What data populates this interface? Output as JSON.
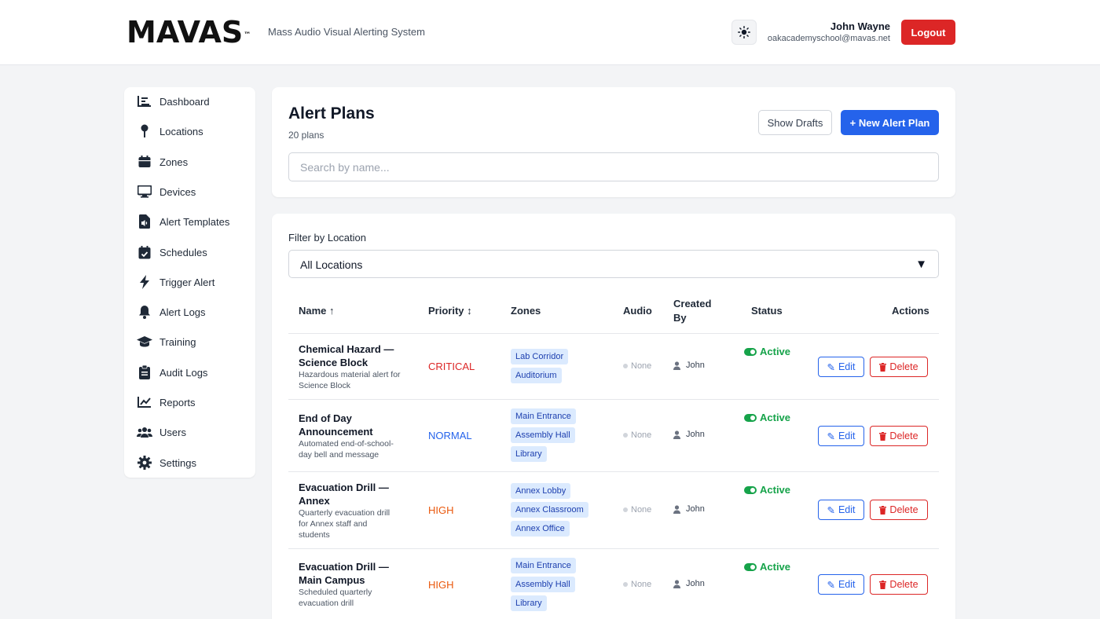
{
  "header": {
    "logo": "MAVAS",
    "logo_tm": "™",
    "tagline": "Mass Audio Visual Alerting System",
    "theme_icon": "sun-icon",
    "user_name": "John Wayne",
    "user_email": "oakacademyschool@mavas.net",
    "logout_label": "Logout"
  },
  "sidebar": {
    "items": [
      {
        "label": "Dashboard",
        "icon": "chart-icon"
      },
      {
        "label": "Locations",
        "icon": "pin-icon"
      },
      {
        "label": "Zones",
        "icon": "calendar-box-icon"
      },
      {
        "label": "Devices",
        "icon": "monitor-icon"
      },
      {
        "label": "Alert Templates",
        "icon": "file-audio-icon"
      },
      {
        "label": "Schedules",
        "icon": "calendar-check-icon"
      },
      {
        "label": "Trigger Alert",
        "icon": "bolt-icon"
      },
      {
        "label": "Alert Logs",
        "icon": "bell-icon"
      },
      {
        "label": "Training",
        "icon": "graduation-cap-icon"
      },
      {
        "label": "Audit Logs",
        "icon": "clipboard-icon"
      },
      {
        "label": "Reports",
        "icon": "line-chart-icon"
      },
      {
        "label": "Users",
        "icon": "users-icon"
      },
      {
        "label": "Settings",
        "icon": "gear-icon"
      }
    ]
  },
  "main": {
    "title": "Alert Plans",
    "count": "20 plans",
    "show_drafts_label": "Show Drafts",
    "new_plan_label": "+ New Alert Plan",
    "search_placeholder": "Search by name...",
    "filter_label": "Filter by Location",
    "filter_value": "All Locations",
    "filter_caret": "▼"
  },
  "table": {
    "headers": {
      "name": "Name ↑",
      "priority": "Priority ↕",
      "zones": "Zones",
      "audio": "Audio",
      "created_by_1": "Created",
      "created_by_2": "By",
      "status": "Status",
      "actions": "Actions"
    },
    "edit_label": "Edit",
    "delete_label": "Delete",
    "rows": [
      {
        "name_1": "Chemical Hazard —",
        "name_2": "Science Block",
        "desc_1": "Hazardous material alert for",
        "desc_2": "Science Block",
        "desc_3": "",
        "priority": "CRITICAL",
        "priority_color": "#dc2626",
        "zones": [
          "Lab Corridor",
          "Auditorium"
        ],
        "audio": "None",
        "created_by": "John",
        "status": "Active"
      },
      {
        "name_1": "End of Day",
        "name_2": "Announcement",
        "desc_1": "Automated end-of-school-",
        "desc_2": "day bell and message",
        "desc_3": "",
        "priority": "NORMAL",
        "priority_color": "#2563eb",
        "zones": [
          "Main Entrance",
          "Assembly Hall",
          "Library"
        ],
        "audio": "None",
        "created_by": "John",
        "status": "Active"
      },
      {
        "name_1": "Evacuation Drill —",
        "name_2": "Annex",
        "desc_1": "Quarterly evacuation drill",
        "desc_2": "for Annex staff and",
        "desc_3": "students",
        "priority": "HIGH",
        "priority_color": "#ea580c",
        "zones": [
          "Annex Lobby",
          "Annex Classroom",
          "Annex Office"
        ],
        "audio": "None",
        "created_by": "John",
        "status": "Active"
      },
      {
        "name_1": "Evacuation Drill —",
        "name_2": "Main Campus",
        "desc_1": "Scheduled quarterly",
        "desc_2": "evacuation drill",
        "desc_3": "",
        "priority": "HIGH",
        "priority_color": "#ea580c",
        "zones": [
          "Main Entrance",
          "Assembly Hall",
          "Library"
        ],
        "audio": "None",
        "created_by": "John",
        "status": "Active"
      }
    ]
  }
}
